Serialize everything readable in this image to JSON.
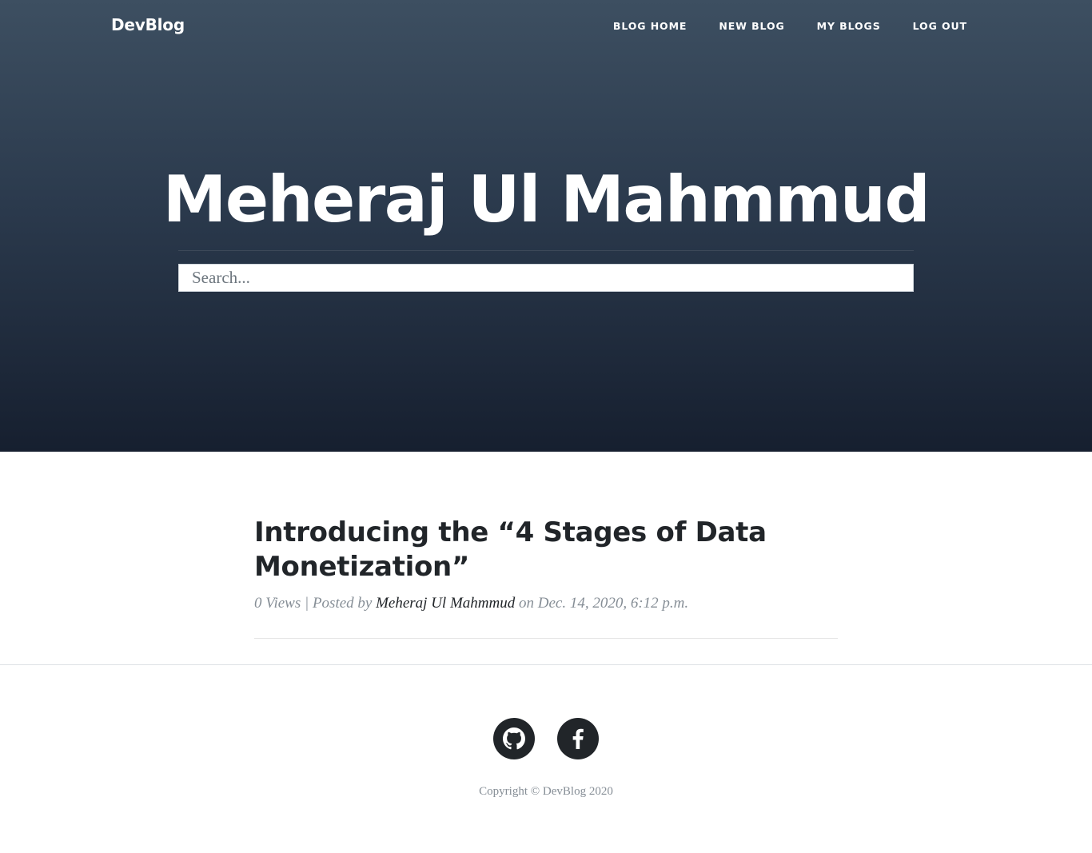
{
  "navbar": {
    "brand": "DevBlog",
    "links": [
      "Blog Home",
      "New Blog",
      "My Blogs",
      "Log Out"
    ]
  },
  "hero": {
    "title": "Meheraj Ul Mahmmud",
    "search_placeholder": "Search..."
  },
  "post": {
    "title": "Introducing the “4 Stages of Data Monetization”",
    "views": "0 Views | Posted by",
    "author": "Meheraj Ul Mahmmud",
    "date": "on Dec. 14, 2020, 6:12 p.m."
  },
  "footer": {
    "social_icons": [
      "github-icon",
      "facebook-icon"
    ],
    "copyright": "Copyright © DevBlog 2020"
  },
  "colors": {
    "hero_top": "#3d4f61",
    "hero_bottom": "#161f2f",
    "text_dark": "#212529",
    "text_muted": "#868e96"
  }
}
